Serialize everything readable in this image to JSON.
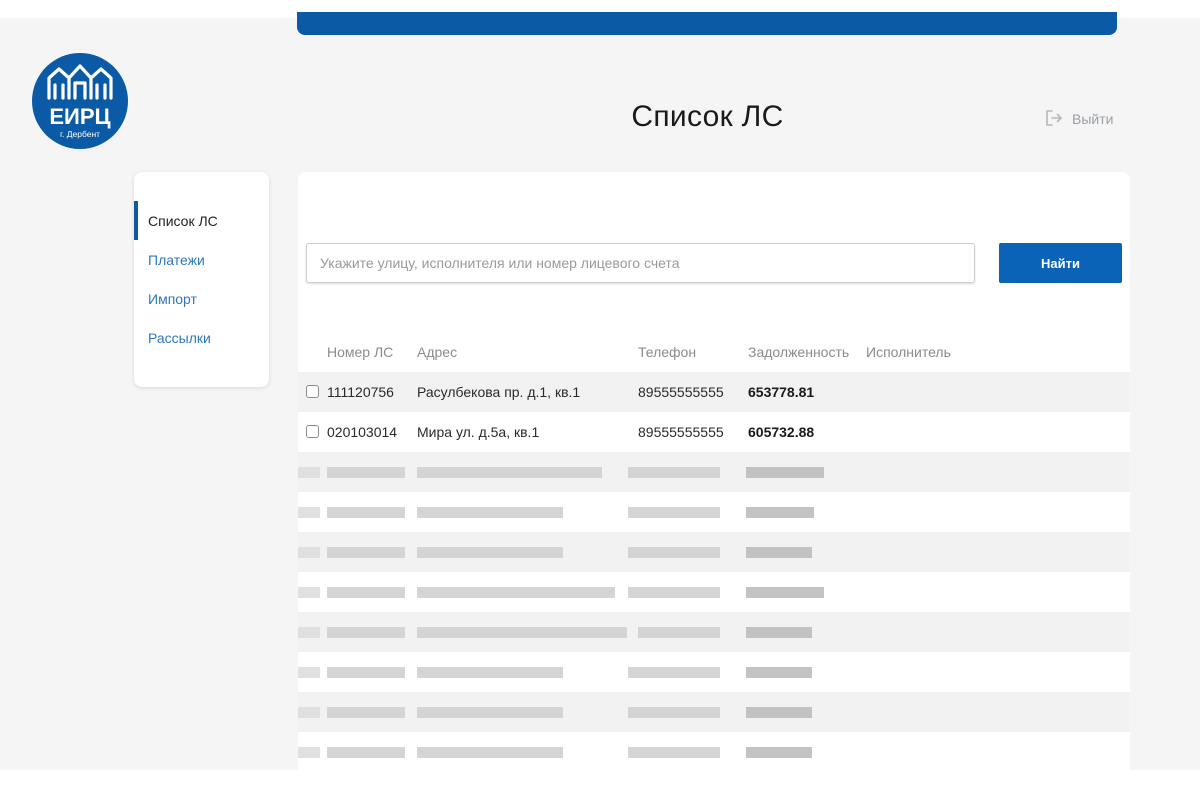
{
  "logo": {
    "brand": "ЕИРЦ",
    "city": "г. Дербент"
  },
  "header": {
    "title": "Список ЛС",
    "logout_label": "Выйти"
  },
  "sidebar": {
    "items": [
      {
        "label": "Список ЛС",
        "active": true
      },
      {
        "label": "Платежи",
        "active": false
      },
      {
        "label": "Импорт",
        "active": false
      },
      {
        "label": "Рассылки",
        "active": false
      }
    ]
  },
  "search": {
    "placeholder": "Укажите улицу, исполнителя или номер лицевого счета",
    "value": "",
    "button_label": "Найти"
  },
  "table": {
    "columns": [
      "Номер ЛС",
      "Адрес",
      "Телефон",
      "Задолженность",
      "Исполнитель"
    ],
    "rows": [
      {
        "account": "111120756",
        "address": "Расулбекова пр. д.1, кв.1",
        "phone": "89555555555",
        "debt": "653778.81",
        "executor": ""
      },
      {
        "account": "020103014",
        "address": "Мира ул. д.5а, кв.1",
        "phone": "89555555555",
        "debt": "605732.88",
        "executor": ""
      }
    ],
    "redacted_rows": 8
  },
  "colors": {
    "accent": "#0a5aa6",
    "button": "#0b63b8",
    "link": "#2f78be"
  }
}
